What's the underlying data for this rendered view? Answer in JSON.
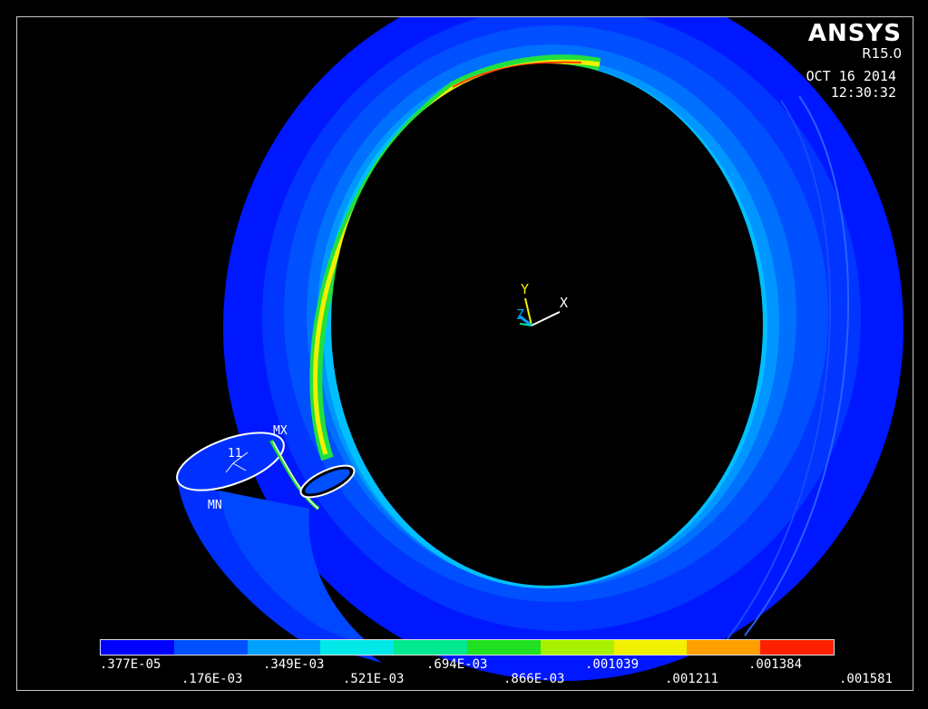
{
  "header": {
    "brand": "ANSYS",
    "release": "R15.0",
    "date": "OCT 16 2014",
    "time": "12:30:32"
  },
  "labels": {
    "max": "MX",
    "min": "MN",
    "node": "11"
  },
  "triad": {
    "y": "Y",
    "x": "X",
    "z": "Z"
  },
  "legend": {
    "colors": [
      "#0000ff",
      "#0050ff",
      "#00a0ff",
      "#00e8e8",
      "#00e890",
      "#20e020",
      "#a8f000",
      "#f0f000",
      "#ffa000",
      "#ff2000"
    ],
    "top_ticks": [
      ".377E-05",
      ".349E-03",
      ".694E-03",
      ".001039",
      ".001384"
    ],
    "bottom_ticks": [
      ".176E-03",
      ".521E-03",
      ".866E-03",
      ".001211",
      ".001581"
    ]
  }
}
